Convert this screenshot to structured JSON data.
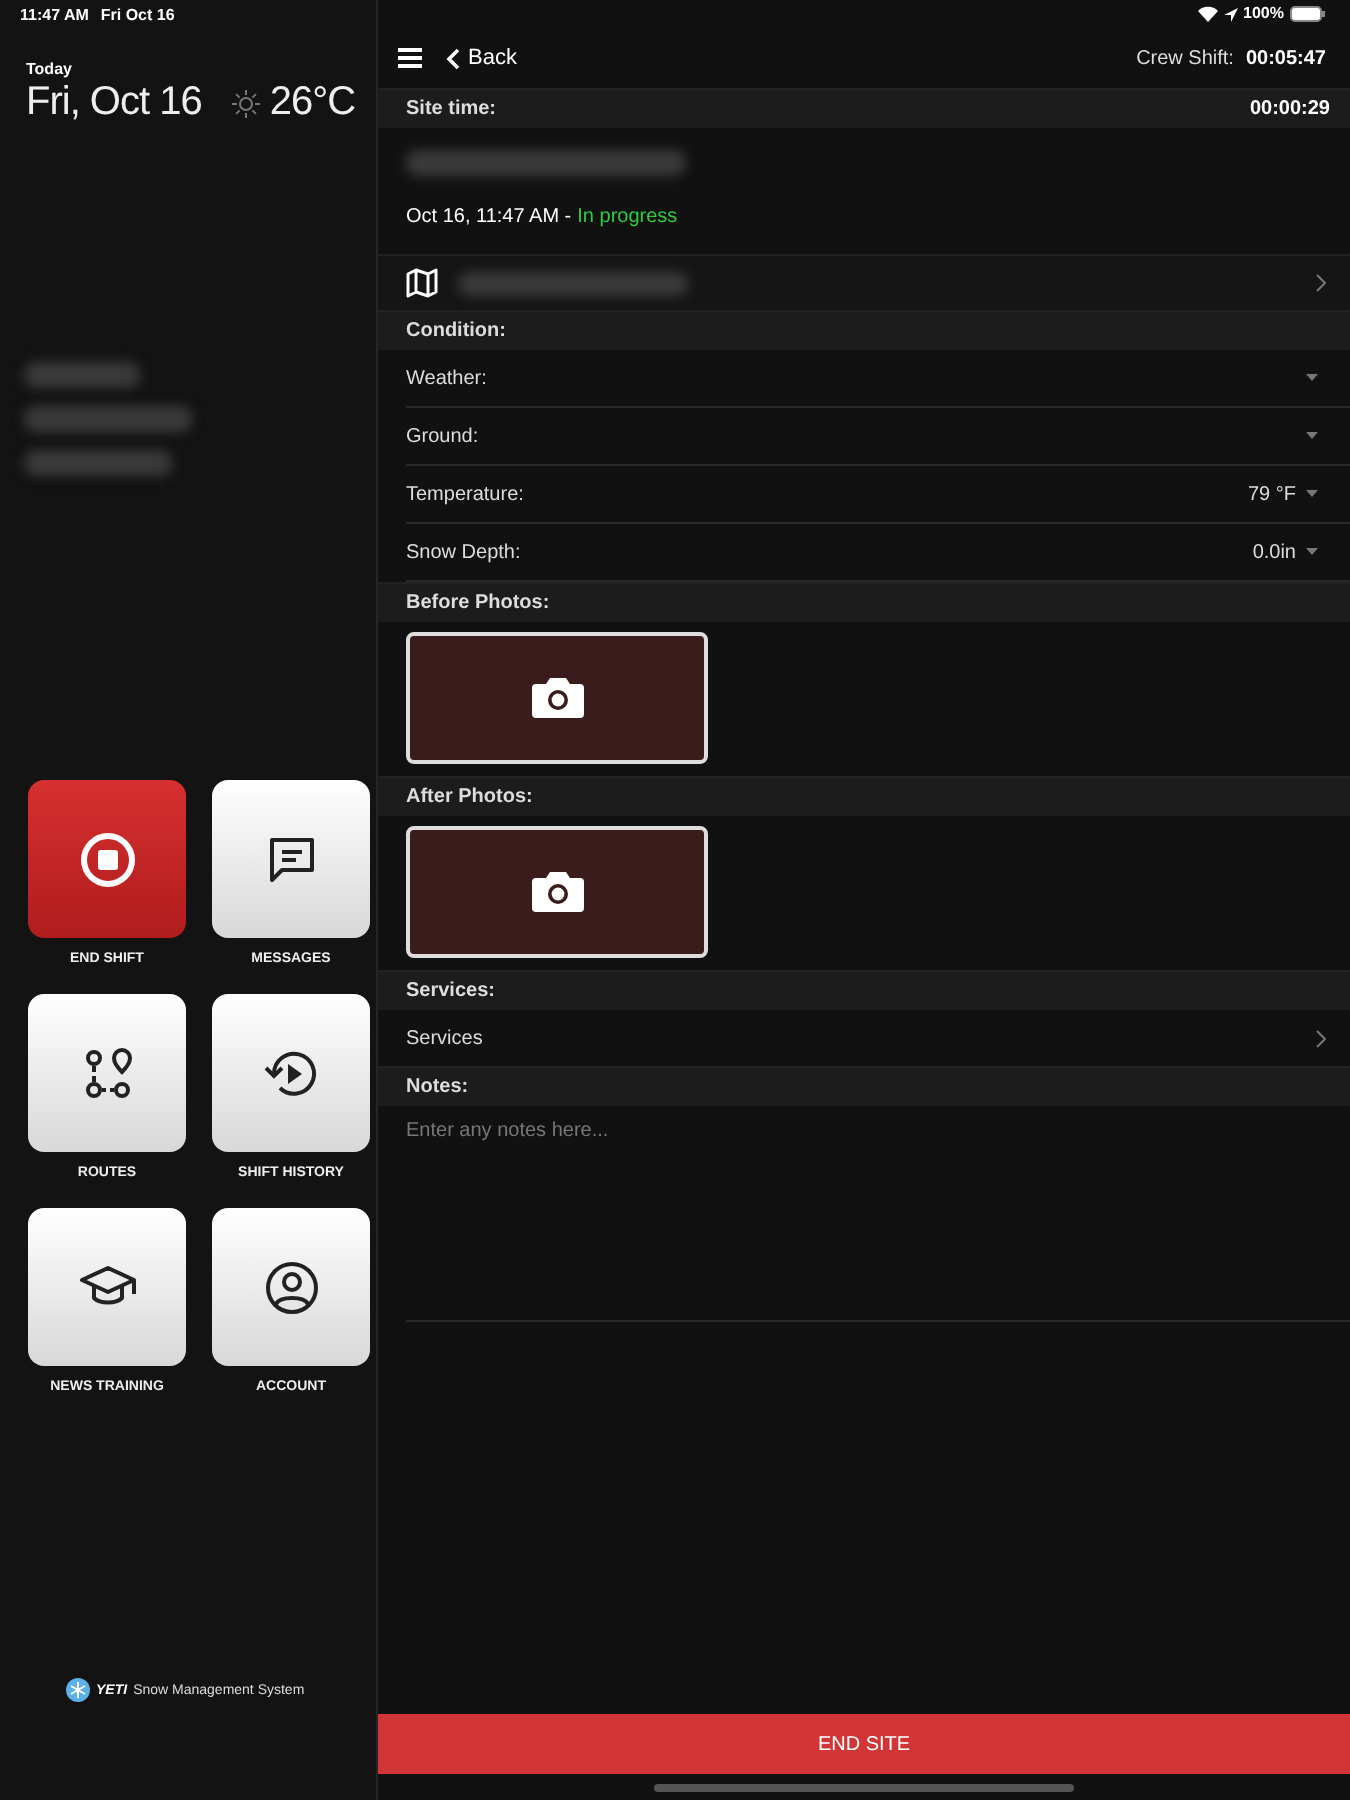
{
  "status_bar": {
    "time": "11:47 AM",
    "date": "Fri Oct 16",
    "battery": "100%"
  },
  "sidebar": {
    "today_label": "Today",
    "date": "Fri, Oct 16",
    "temperature": "26°C",
    "tiles": [
      {
        "label": "END SHIFT",
        "kind": "danger"
      },
      {
        "label": "MESSAGES",
        "kind": "normal"
      },
      {
        "label": "ROUTES",
        "kind": "normal"
      },
      {
        "label": "SHIFT HISTORY",
        "kind": "normal"
      },
      {
        "label": "NEWS TRAINING",
        "kind": "normal"
      },
      {
        "label": "ACCOUNT",
        "kind": "normal"
      }
    ],
    "footer": {
      "logo": "YETI",
      "text": "Snow Management System"
    }
  },
  "header": {
    "back": "Back",
    "crew_shift_label": "Crew Shift:",
    "crew_shift_time": "00:05:47"
  },
  "site": {
    "time_label": "Site time:",
    "time_value": "00:00:29",
    "started": "Oct 16, 11:47 AM -",
    "status": "In progress"
  },
  "condition": {
    "title": "Condition:",
    "fields": [
      {
        "label": "Weather:"
      },
      {
        "label": "Ground:"
      },
      {
        "label": "Temperature:",
        "value": "79 °F"
      },
      {
        "label": "Snow Depth:",
        "value": "0.0in"
      }
    ]
  },
  "photo_sections": [
    {
      "title": "Before Photos:"
    },
    {
      "title": "After Photos:"
    }
  ],
  "services": {
    "title": "Services:",
    "row": "Services"
  },
  "notes": {
    "title": "Notes:",
    "placeholder": "Enter any notes here..."
  },
  "end_site": "END SITE"
}
